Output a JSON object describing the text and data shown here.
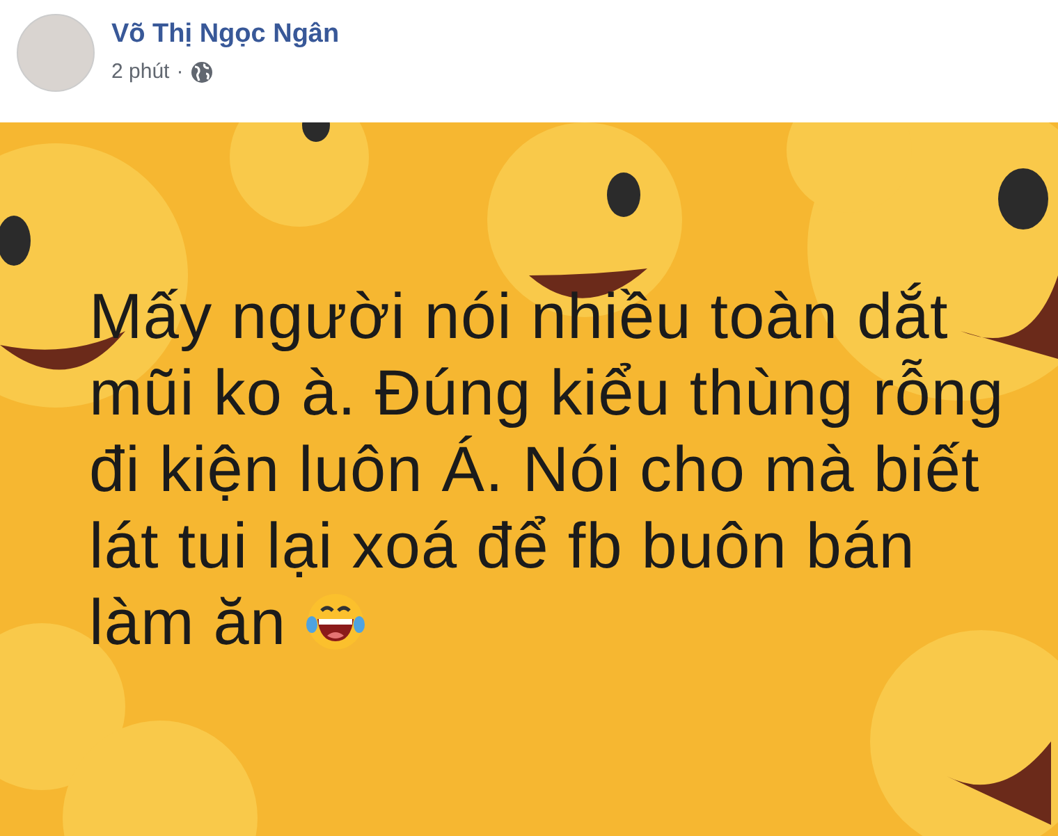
{
  "post": {
    "author": "Võ Thị Ngọc Ngân",
    "time": "2 phút",
    "separator": "·",
    "text": "Mấy người nói nhiều toàn dắt\nmũi ko à. Đúng kiểu thùng rỗng\nđi kiện luôn Á. Nói cho mà biết\nlát tui lại xoá để fb buôn bán\nlàm ăn"
  }
}
